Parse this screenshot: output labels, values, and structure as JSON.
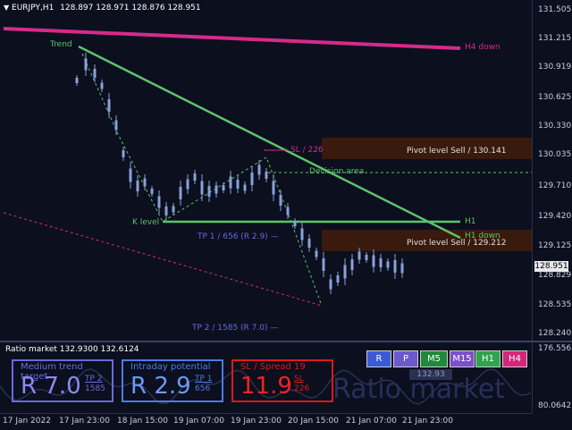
{
  "header": {
    "symbol": "EURJPY,H1",
    "ohlc": "128.897 128.971 128.876 128.951"
  },
  "price_axis": {
    "ticks": [
      "131.505",
      "131.215",
      "130.919",
      "130.625",
      "130.330",
      "130.035",
      "129.710",
      "129.420",
      "129.125",
      "128.829",
      "128.535",
      "128.240"
    ],
    "current_price": "128.951"
  },
  "annotations": {
    "trend": "Trend",
    "h4_down": "H4 down",
    "sl": "SL / 226",
    "pivot_sell_1": "Pivot level Sell / 130.141",
    "decision_area": "Decision area",
    "h1": "H1",
    "h1_down": "H1 down",
    "k_level": "K level",
    "tp1": "TP 1 / 656 (R 2.9) —",
    "pivot_sell_2": "Pivot level Sell / 129.212",
    "tp2": "TP 2 / 1585 (R 7.0) —"
  },
  "subwindow": {
    "title": "Ratio market 132.9300 132.6124",
    "axis_top": "176.5565",
    "axis_bottom": "80.06425",
    "value_tag": "132.93",
    "watermark": "Ratio market"
  },
  "timeframe_buttons": [
    {
      "label": "R",
      "color": "#3b5bd6"
    },
    {
      "label": "P",
      "color": "#6a5acd"
    },
    {
      "label": "M5",
      "color": "#1e8a3a"
    },
    {
      "label": "M15",
      "color": "#7a4fc9"
    },
    {
      "label": "H1",
      "color": "#2ea44f"
    },
    {
      "label": "H4",
      "color": "#d6267c"
    }
  ],
  "panels": {
    "medium": {
      "title": "Medium trend target",
      "value": "R 7.0",
      "tp": "TP 2",
      "pts": "1585",
      "color": "#6a6ae0"
    },
    "intraday": {
      "title": "Intraday potential",
      "value": "R 2.9",
      "tp": "TP 1",
      "pts": "656",
      "color": "#4f7ae8"
    },
    "sl": {
      "title": "SL / Spread 19",
      "value": "11.9",
      "tp": "SL",
      "pts": "226",
      "color": "#e01818"
    }
  },
  "time_axis": [
    "17 Jan 2022",
    "17 Jan 23:00",
    "18 Jan 15:00",
    "19 Jan 07:00",
    "19 Jan 23:00",
    "20 Jan 15:00",
    "21 Jan 07:00",
    "21 Jan 23:00"
  ],
  "colors": {
    "h4_line": "#d62a8a",
    "trend_line": "#5cc46a",
    "zone": "#3a1a0c",
    "candles": "#8aa0d8"
  }
}
